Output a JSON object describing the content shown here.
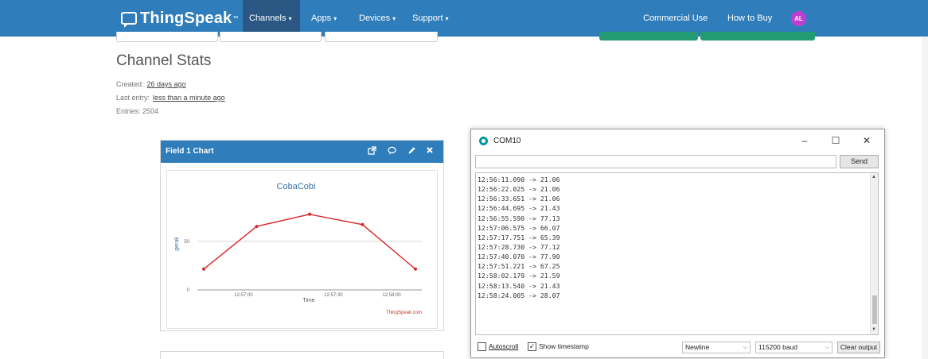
{
  "navbar": {
    "brand": "ThingSpeak",
    "brand_tm": "™",
    "items": [
      {
        "label": "Channels",
        "caret": "▾"
      },
      {
        "label": "Apps",
        "caret": "▾"
      },
      {
        "label": "Devices",
        "caret": "▾"
      },
      {
        "label": "Support",
        "caret": "▾"
      }
    ],
    "right_items": [
      "Commercial Use",
      "How to Buy"
    ],
    "avatar_initials": "AL",
    "colors": {
      "bar": "#2f7dbb",
      "active": "#2a5783",
      "avatar": "#c13ed4"
    }
  },
  "channel_stats": {
    "title": "Channel Stats",
    "created_label": "Created:",
    "created_value": "26 days ago",
    "last_entry_label": "Last entry:",
    "last_entry_value": "less than a minute ago",
    "entries": "Entries: 2504"
  },
  "chart_widget": {
    "header_title": "Field 1 Chart",
    "icons": [
      "external-link-icon",
      "comment-icon",
      "pencil-icon",
      "close-icon"
    ],
    "brand_credit": "ThingSpeak.com"
  },
  "chart_data": {
    "type": "line",
    "title": "CobaCobi",
    "xlabel": "Time",
    "ylabel": "gerak",
    "x_ticks": [
      "12:57:00",
      "12:57:30",
      "12:58:00"
    ],
    "y_ticks": [
      "0",
      "50"
    ],
    "ylim": [
      0,
      90
    ],
    "series": [
      {
        "values": [
          21.43,
          65.39,
          77.9,
          67.25,
          21.43
        ]
      }
    ],
    "line_color": "#d62728",
    "grid": true
  },
  "serial_monitor": {
    "title": "COM10",
    "controls": {
      "minimize": "–",
      "maximize": "☐",
      "close": "✕"
    },
    "send_label": "Send",
    "input_value": "",
    "lines": [
      "12:56:11.090 -> 21.06",
      "12:56:22.025 -> 21.06",
      "12:56:33.651 -> 21.06",
      "12:56:44.695 -> 21.43",
      "12:56:55.590 -> 77.13",
      "12:57:06.575 -> 66.07",
      "12:57:17.751 -> 65.39",
      "12:57:28.730 -> 77.12",
      "12:57:40.070 -> 77.90",
      "12:57:51.221 -> 67.25",
      "12:58:02.179 -> 21.59",
      "12:58:13.540 -> 21.43",
      "12:58:24.005 -> 28.07"
    ],
    "autoscroll_label": "Autoscroll",
    "autoscroll_checked": false,
    "timestamp_label": "Show timestamp",
    "timestamp_checked": true,
    "line_ending": "Newline",
    "baud": "115200 baud",
    "clear_label": "Clear output",
    "check_mark": "✓",
    "scroll_up": "▲",
    "scroll_down": "▼",
    "dropdown_arrow": "⌵"
  }
}
